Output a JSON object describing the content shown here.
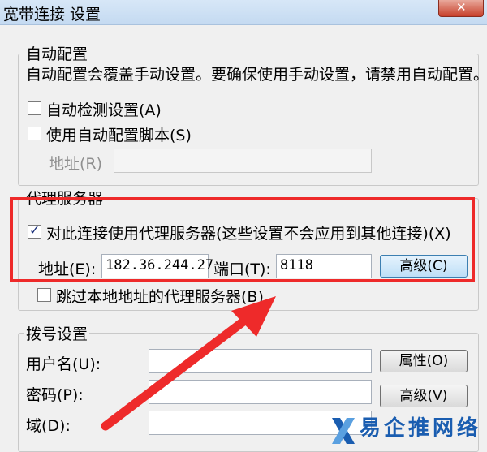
{
  "window": {
    "title": "宽带连接 设置",
    "close_icon": "x-icon"
  },
  "auto_config": {
    "group_label": "自动配置",
    "description": "自动配置会覆盖手动设置。要确保使用手动设置，请禁用自动配置。",
    "auto_detect_label": "自动检测设置(A)",
    "auto_detect_checked": false,
    "script_label": "使用自动配置脚本(S)",
    "script_checked": false,
    "address_label": "地址(R)",
    "address_value": ""
  },
  "proxy": {
    "group_label": "代理服务器",
    "use_proxy_label": "对此连接使用代理服务器(这些设置不会应用到其他连接)(X)",
    "use_proxy_checked": true,
    "address_label": "地址(E):",
    "address_value": "182.36.244.27",
    "port_label": "端口(T):",
    "port_value": "8118",
    "advanced_label": "高级(C)",
    "bypass_label": "跳过本地地址的代理服务器(B)",
    "bypass_checked": false
  },
  "dialup": {
    "group_label": "拨号设置",
    "username_label": "用户名(U):",
    "username_value": "",
    "password_label": "密码(P):",
    "password_value": "",
    "domain_label": "域(D):",
    "domain_value": "",
    "properties_label": "属性(O)",
    "advanced_label": "高级(V)"
  },
  "annotation": {
    "highlight_color": "#ee2a2a",
    "arrow_color": "#ee2a2a"
  },
  "watermark": {
    "text": "易企推网络",
    "logo_icon": "x-logo-icon",
    "color": "#1a5db0"
  }
}
